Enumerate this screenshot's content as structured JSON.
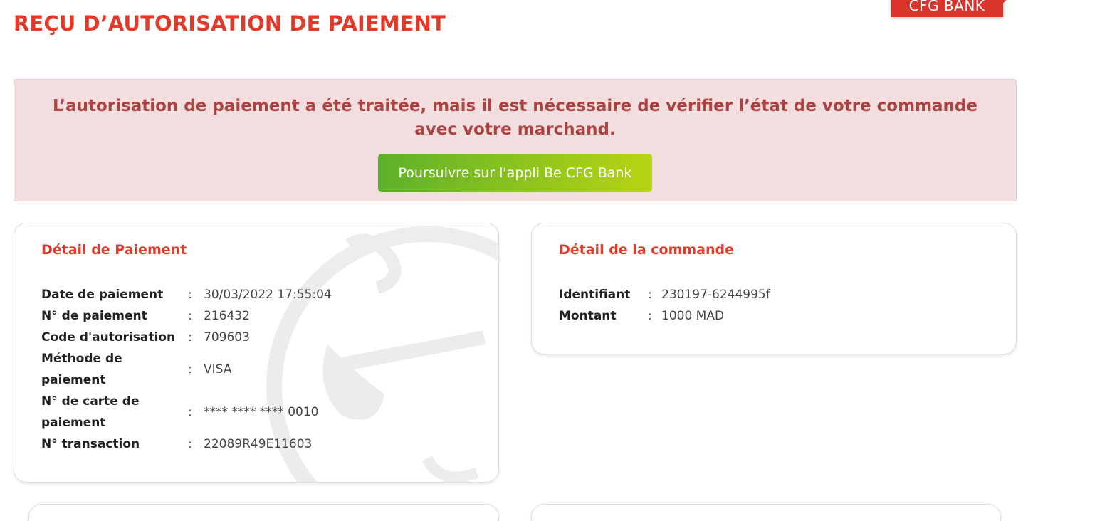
{
  "brand": {
    "label": "CFG BANK",
    "color": "#d9342b"
  },
  "page": {
    "title": "REÇU D’AUTORISATION DE PAIEMENT"
  },
  "alert": {
    "message": "L’autorisation de paiement a été traitée, mais il est nécessaire de vérifier l’état de votre commande avec votre marchand.",
    "button_label": "Poursuivre sur l'appli Be CFG Bank"
  },
  "payment": {
    "title": "Détail de Paiement",
    "separator": ":",
    "rows": [
      {
        "label": "Date de paiement",
        "value": "30/03/2022 17:55:04"
      },
      {
        "label": "N° de paiement",
        "value": "216432"
      },
      {
        "label": "Code d'autorisation",
        "value": "709603"
      },
      {
        "label": "Méthode de paiement",
        "value": "VISA"
      },
      {
        "label": "N° de carte de paiement",
        "value": "**** **** **** 0010"
      },
      {
        "label": "N° transaction",
        "value": "22089R49E11603"
      }
    ]
  },
  "order": {
    "title": "Détail de la commande",
    "separator": ":",
    "rows": [
      {
        "label": "Identifiant",
        "value": "230197-6244995f"
      },
      {
        "label": "Montant",
        "value": "1000 MAD"
      }
    ]
  },
  "colors": {
    "accent": "#e03a2b",
    "alert_bg": "#f2dede",
    "alert_text": "#a94442",
    "button_gradient_start": "#5db12a",
    "button_gradient_end": "#b8d413"
  }
}
